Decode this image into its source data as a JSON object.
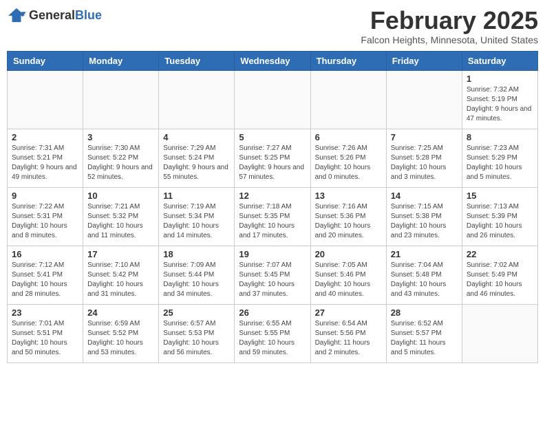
{
  "header": {
    "logo_general": "General",
    "logo_blue": "Blue",
    "month_year": "February 2025",
    "location": "Falcon Heights, Minnesota, United States"
  },
  "weekdays": [
    "Sunday",
    "Monday",
    "Tuesday",
    "Wednesday",
    "Thursday",
    "Friday",
    "Saturday"
  ],
  "weeks": [
    [
      {
        "day": "",
        "info": ""
      },
      {
        "day": "",
        "info": ""
      },
      {
        "day": "",
        "info": ""
      },
      {
        "day": "",
        "info": ""
      },
      {
        "day": "",
        "info": ""
      },
      {
        "day": "",
        "info": ""
      },
      {
        "day": "1",
        "info": "Sunrise: 7:32 AM\nSunset: 5:19 PM\nDaylight: 9 hours and 47 minutes."
      }
    ],
    [
      {
        "day": "2",
        "info": "Sunrise: 7:31 AM\nSunset: 5:21 PM\nDaylight: 9 hours and 49 minutes."
      },
      {
        "day": "3",
        "info": "Sunrise: 7:30 AM\nSunset: 5:22 PM\nDaylight: 9 hours and 52 minutes."
      },
      {
        "day": "4",
        "info": "Sunrise: 7:29 AM\nSunset: 5:24 PM\nDaylight: 9 hours and 55 minutes."
      },
      {
        "day": "5",
        "info": "Sunrise: 7:27 AM\nSunset: 5:25 PM\nDaylight: 9 hours and 57 minutes."
      },
      {
        "day": "6",
        "info": "Sunrise: 7:26 AM\nSunset: 5:26 PM\nDaylight: 10 hours and 0 minutes."
      },
      {
        "day": "7",
        "info": "Sunrise: 7:25 AM\nSunset: 5:28 PM\nDaylight: 10 hours and 3 minutes."
      },
      {
        "day": "8",
        "info": "Sunrise: 7:23 AM\nSunset: 5:29 PM\nDaylight: 10 hours and 5 minutes."
      }
    ],
    [
      {
        "day": "9",
        "info": "Sunrise: 7:22 AM\nSunset: 5:31 PM\nDaylight: 10 hours and 8 minutes."
      },
      {
        "day": "10",
        "info": "Sunrise: 7:21 AM\nSunset: 5:32 PM\nDaylight: 10 hours and 11 minutes."
      },
      {
        "day": "11",
        "info": "Sunrise: 7:19 AM\nSunset: 5:34 PM\nDaylight: 10 hours and 14 minutes."
      },
      {
        "day": "12",
        "info": "Sunrise: 7:18 AM\nSunset: 5:35 PM\nDaylight: 10 hours and 17 minutes."
      },
      {
        "day": "13",
        "info": "Sunrise: 7:16 AM\nSunset: 5:36 PM\nDaylight: 10 hours and 20 minutes."
      },
      {
        "day": "14",
        "info": "Sunrise: 7:15 AM\nSunset: 5:38 PM\nDaylight: 10 hours and 23 minutes."
      },
      {
        "day": "15",
        "info": "Sunrise: 7:13 AM\nSunset: 5:39 PM\nDaylight: 10 hours and 26 minutes."
      }
    ],
    [
      {
        "day": "16",
        "info": "Sunrise: 7:12 AM\nSunset: 5:41 PM\nDaylight: 10 hours and 28 minutes."
      },
      {
        "day": "17",
        "info": "Sunrise: 7:10 AM\nSunset: 5:42 PM\nDaylight: 10 hours and 31 minutes."
      },
      {
        "day": "18",
        "info": "Sunrise: 7:09 AM\nSunset: 5:44 PM\nDaylight: 10 hours and 34 minutes."
      },
      {
        "day": "19",
        "info": "Sunrise: 7:07 AM\nSunset: 5:45 PM\nDaylight: 10 hours and 37 minutes."
      },
      {
        "day": "20",
        "info": "Sunrise: 7:05 AM\nSunset: 5:46 PM\nDaylight: 10 hours and 40 minutes."
      },
      {
        "day": "21",
        "info": "Sunrise: 7:04 AM\nSunset: 5:48 PM\nDaylight: 10 hours and 43 minutes."
      },
      {
        "day": "22",
        "info": "Sunrise: 7:02 AM\nSunset: 5:49 PM\nDaylight: 10 hours and 46 minutes."
      }
    ],
    [
      {
        "day": "23",
        "info": "Sunrise: 7:01 AM\nSunset: 5:51 PM\nDaylight: 10 hours and 50 minutes."
      },
      {
        "day": "24",
        "info": "Sunrise: 6:59 AM\nSunset: 5:52 PM\nDaylight: 10 hours and 53 minutes."
      },
      {
        "day": "25",
        "info": "Sunrise: 6:57 AM\nSunset: 5:53 PM\nDaylight: 10 hours and 56 minutes."
      },
      {
        "day": "26",
        "info": "Sunrise: 6:55 AM\nSunset: 5:55 PM\nDaylight: 10 hours and 59 minutes."
      },
      {
        "day": "27",
        "info": "Sunrise: 6:54 AM\nSunset: 5:56 PM\nDaylight: 11 hours and 2 minutes."
      },
      {
        "day": "28",
        "info": "Sunrise: 6:52 AM\nSunset: 5:57 PM\nDaylight: 11 hours and 5 minutes."
      },
      {
        "day": "",
        "info": ""
      }
    ]
  ]
}
